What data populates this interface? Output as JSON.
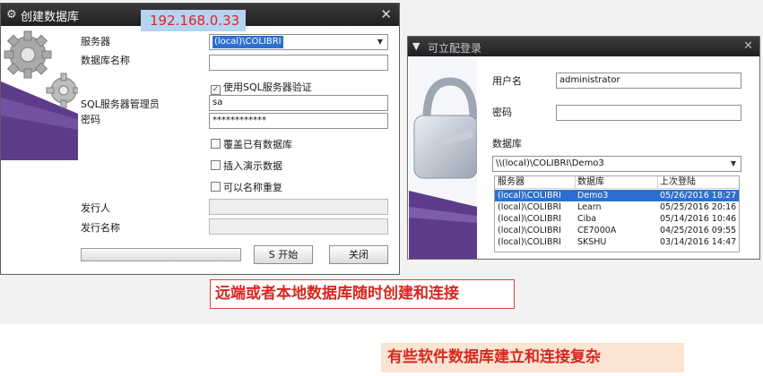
{
  "create_dialog": {
    "title": "创建数据库",
    "ip": "192.168.0.33",
    "server_label": "服务器",
    "server_value": "(local)\\COLIBRI",
    "dbname_label": "数据库名称",
    "dbname_value": "",
    "use_sql_auth_label": "使用SQL服务器验证",
    "use_sql_auth_checked": true,
    "sql_admin_label": "SQL服务器管理员",
    "sql_admin_value": "sa",
    "password_label": "密码",
    "password_value": "************",
    "overwrite_label": "覆盖已有数据库",
    "insert_demo_label": "插入演示数据",
    "allow_dup_label": "可以名称重复",
    "publisher_label": "发行人",
    "publisher_name_label": "发行名称",
    "start_button": "S 开始",
    "close_button": "关闭"
  },
  "login_dialog": {
    "title": "可立配登录",
    "username_label": "用户名",
    "username_value": "administrator",
    "password_label": "密码",
    "password_value": "",
    "database_label": "数据库",
    "database_value": "\\\\(local)\\COLIBRI\\Demo3",
    "table": {
      "headers": [
        "服务器",
        "数据库",
        "上次登陆"
      ],
      "rows": [
        {
          "server": "(local)\\COLIBRI",
          "database": "Demo3",
          "last_login": "05/26/2016 18:27",
          "selected": true
        },
        {
          "server": "(local)\\COLIBRI",
          "database": "Learn",
          "last_login": "05/25/2016 20:16",
          "selected": false
        },
        {
          "server": "(local)\\COLIBRI",
          "database": "Ciba",
          "last_login": "05/14/2016 10:46",
          "selected": false
        },
        {
          "server": "(local)\\COLIBRI",
          "database": "CE7000A",
          "last_login": "04/25/2016 09:55",
          "selected": false
        },
        {
          "server": "(local)\\COLIBRI",
          "database": "SKSHU",
          "last_login": "03/14/2016 14:47",
          "selected": false
        }
      ]
    }
  },
  "captions": {
    "main": "远端或者本地数据库随时创建和连接",
    "secondary": "有些软件数据库建立和连接复杂"
  },
  "colors": {
    "accent_purple": "#5d3c8c",
    "selection_blue": "#2b6fd0",
    "caption_red": "#d9261f",
    "caption_bg": "#fce4d2",
    "ip_bg": "#b5d3f2"
  }
}
